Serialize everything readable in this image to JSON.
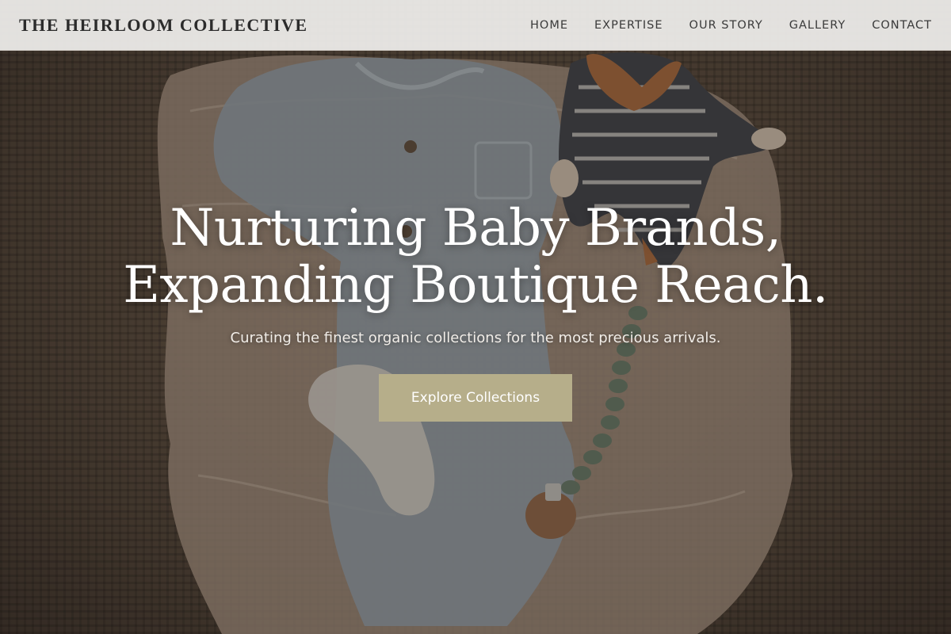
{
  "header": {
    "logo": "THE HEIRLOOM COLLECTIVE",
    "nav": [
      {
        "label": "HOME"
      },
      {
        "label": "EXPERTISE"
      },
      {
        "label": "OUR STORY"
      },
      {
        "label": "GALLERY"
      },
      {
        "label": "CONTACT"
      }
    ]
  },
  "hero": {
    "title_line1": "Nurturing Baby Brands,",
    "title_line2": "Expanding Boutique Reach.",
    "subtitle": "Curating the finest organic collections for the most precious arrivals.",
    "cta_label": "Explore Collections",
    "background_image_name": "baby-clothes-flatlay-photo"
  },
  "colors": {
    "header_bg": "#f0efed",
    "logo_text": "#2b2b2b",
    "nav_text": "#3a3a3a",
    "title_text": "#ffffff",
    "cta_bg": "#b6ae8a",
    "cta_text": "#ffffff",
    "rug_brown": "#4b3f33"
  }
}
